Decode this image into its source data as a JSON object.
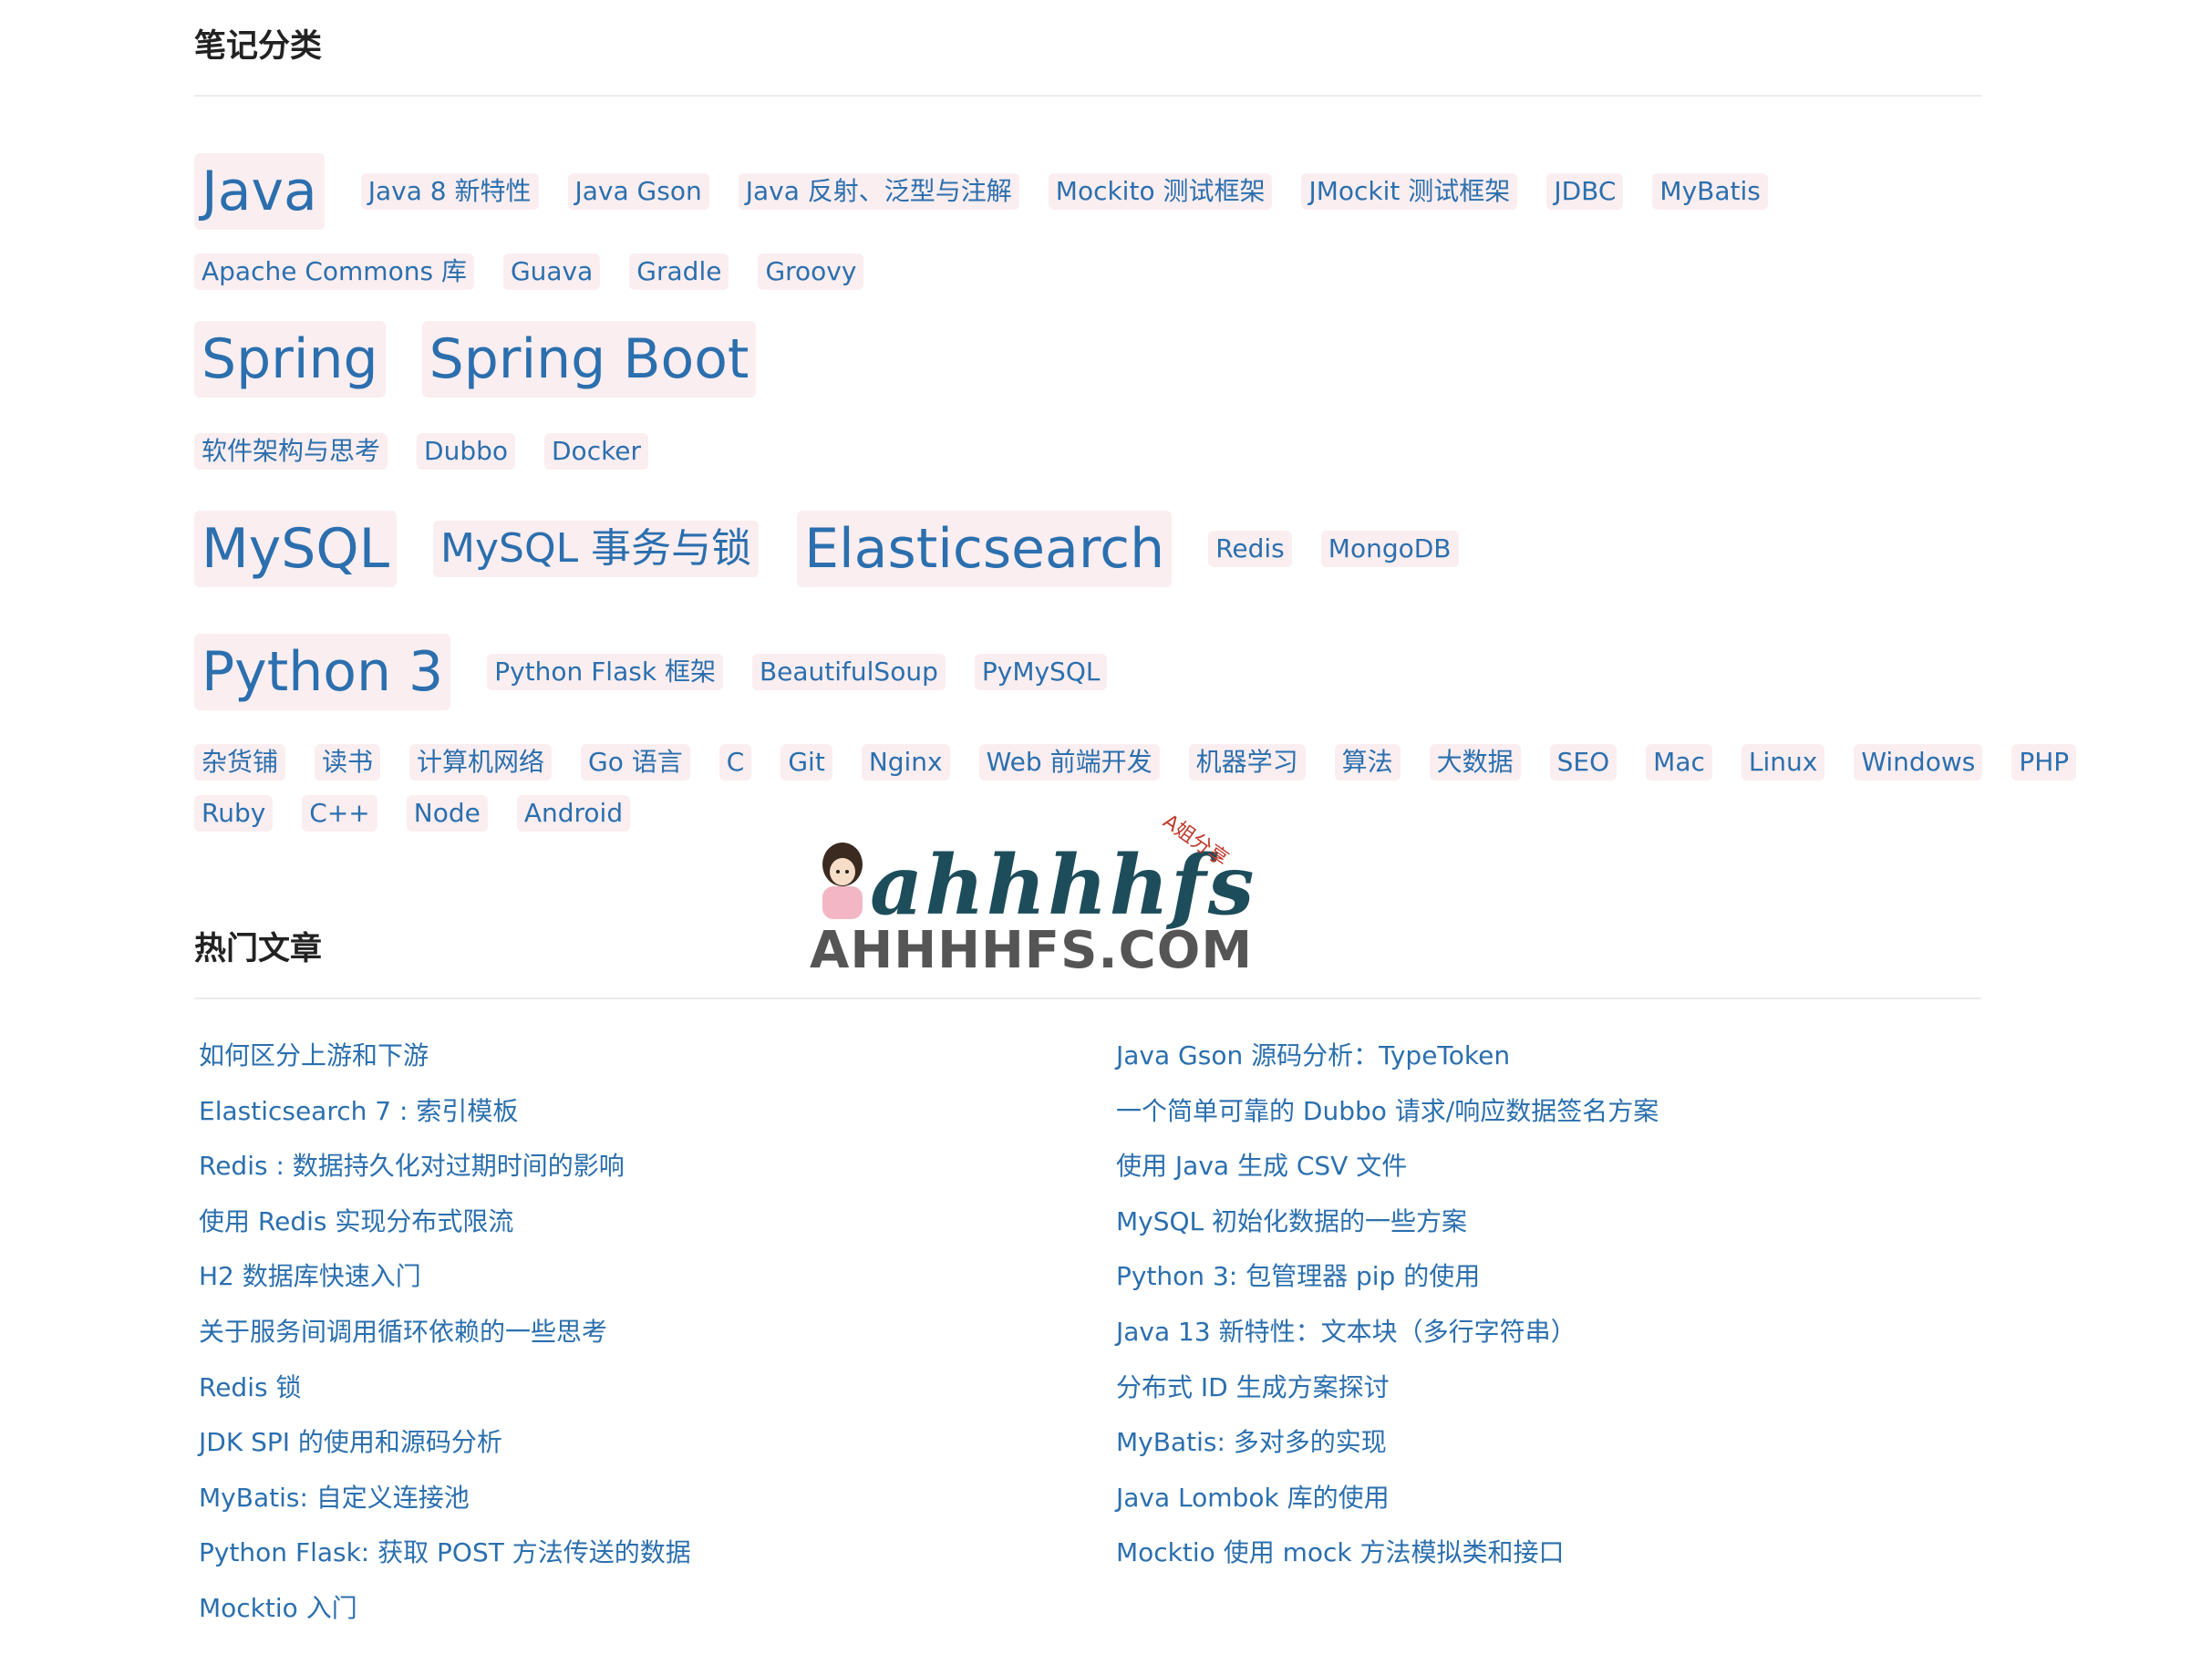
{
  "categories": {
    "title": "笔记分类",
    "rows": [
      [
        {
          "label": "Java",
          "size": "xl"
        },
        {
          "label": "Java 8 新特性",
          "size": "s"
        },
        {
          "label": "Java Gson",
          "size": "s"
        },
        {
          "label": "Java 反射、泛型与注解",
          "size": "s"
        },
        {
          "label": "Mockito 测试框架",
          "size": "s"
        },
        {
          "label": "JMockit 测试框架",
          "size": "s"
        },
        {
          "label": "JDBC",
          "size": "s"
        },
        {
          "label": "MyBatis",
          "size": "s"
        }
      ],
      [
        {
          "label": "Apache Commons 库",
          "size": "s"
        },
        {
          "label": "Guava",
          "size": "s"
        },
        {
          "label": "Gradle",
          "size": "s"
        },
        {
          "label": "Groovy",
          "size": "s"
        }
      ],
      [
        {
          "label": "Spring",
          "size": "xl"
        },
        {
          "label": "Spring Boot",
          "size": "xl"
        }
      ],
      [
        {
          "label": "软件架构与思考",
          "size": "s"
        },
        {
          "label": "Dubbo",
          "size": "s"
        },
        {
          "label": "Docker",
          "size": "s"
        }
      ],
      [
        {
          "label": "MySQL",
          "size": "xl"
        },
        {
          "label": "MySQL 事务与锁",
          "size": "l"
        },
        {
          "label": "Elasticsearch",
          "size": "xl"
        },
        {
          "label": "Redis",
          "size": "s"
        },
        {
          "label": "MongoDB",
          "size": "s"
        }
      ],
      [
        {
          "label": "Python 3",
          "size": "xl"
        },
        {
          "label": "Python Flask 框架",
          "size": "s"
        },
        {
          "label": "BeautifulSoup",
          "size": "s"
        },
        {
          "label": "PyMySQL",
          "size": "s"
        }
      ],
      [
        {
          "label": "杂货铺",
          "size": "s"
        },
        {
          "label": "读书",
          "size": "s"
        },
        {
          "label": "计算机网络",
          "size": "s"
        },
        {
          "label": "Go 语言",
          "size": "s"
        },
        {
          "label": "C",
          "size": "s"
        },
        {
          "label": "Git",
          "size": "s"
        },
        {
          "label": "Nginx",
          "size": "s"
        },
        {
          "label": "Web 前端开发",
          "size": "s"
        },
        {
          "label": "机器学习",
          "size": "s"
        },
        {
          "label": "算法",
          "size": "s"
        },
        {
          "label": "大数据",
          "size": "s"
        },
        {
          "label": "SEO",
          "size": "s"
        },
        {
          "label": "Mac",
          "size": "s"
        },
        {
          "label": "Linux",
          "size": "s"
        },
        {
          "label": "Windows",
          "size": "s"
        },
        {
          "label": "PHP",
          "size": "s"
        }
      ],
      [
        {
          "label": "Ruby",
          "size": "s"
        },
        {
          "label": "C++",
          "size": "s"
        },
        {
          "label": "Node",
          "size": "s"
        },
        {
          "label": "Android",
          "size": "s"
        }
      ]
    ]
  },
  "popular": {
    "title": "热门文章",
    "left": [
      "如何区分上游和下游",
      "Elasticsearch 7 : 索引模板",
      "Redis : 数据持久化对过期时间的影响",
      "使用 Redis 实现分布式限流",
      "H2 数据库快速入门",
      "关于服务间调用循环依赖的一些思考",
      "Redis 锁",
      "JDK SPI 的使用和源码分析",
      "MyBatis: 自定义连接池",
      "Python Flask: 获取 POST 方法传送的数据",
      "Mocktio 入门"
    ],
    "right": [
      "Java Gson 源码分析：TypeToken",
      "一个简单可靠的 Dubbo 请求/响应数据签名方案",
      "使用 Java 生成 CSV 文件",
      "MySQL 初始化数据的一些方案",
      "Python 3: 包管理器 pip 的使用",
      "Java 13 新特性：文本块（多行字符串）",
      "分布式 ID 生成方案探讨",
      "MyBatis: 多对多的实现",
      "Java Lombok 库的使用",
      "Mocktio 使用 mock 方法模拟类和接口"
    ]
  },
  "watermark": {
    "script_text": "ahhhhfs",
    "corner_text": "A姐分享",
    "domain_text": "AHHHHFS.COM"
  },
  "colors": {
    "link": "#2b6fae",
    "tag_bg": "#fbeef0",
    "divider": "#ececec"
  }
}
